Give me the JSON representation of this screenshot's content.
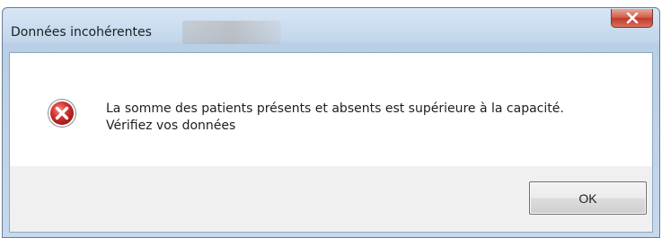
{
  "window": {
    "title": "Données incohérentes"
  },
  "dialog": {
    "icon": "error-icon",
    "message_line1": "La somme des patients présents et absents est supérieure à la capacité.",
    "message_line2": "Vérifiez vos données",
    "ok_label": "OK"
  },
  "colors": {
    "close_button": "#c0392b",
    "error_icon": "#d32f2f",
    "title_bar": "#c6d9ed"
  }
}
